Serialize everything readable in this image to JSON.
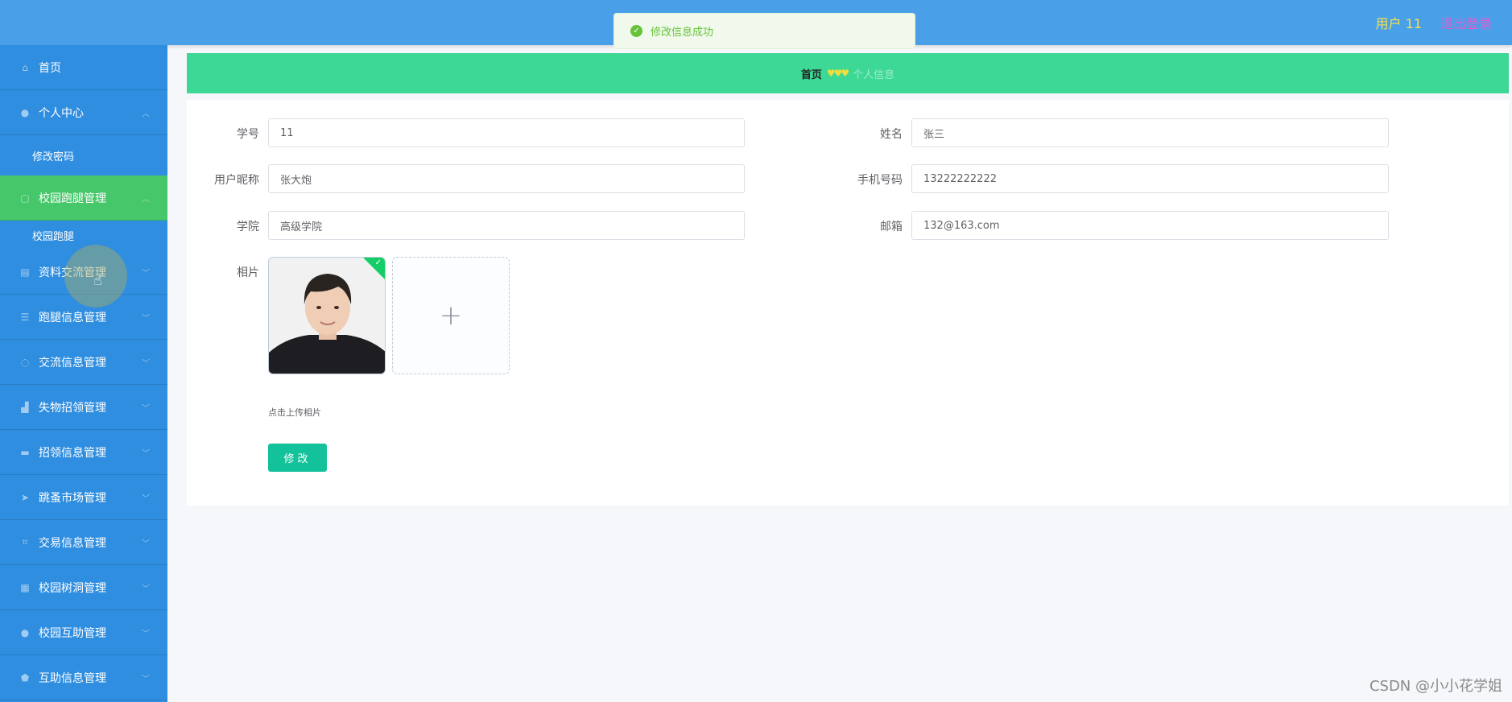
{
  "header": {
    "user_label": "用户 11",
    "logout_label": "退出登录"
  },
  "toast": {
    "message": "修改信息成功",
    "icon": "success-check-icon"
  },
  "sidebar": {
    "items": [
      {
        "label": "首页",
        "icon": "home-icon"
      },
      {
        "label": "个人中心",
        "icon": "user-icon",
        "sub": "修改密码"
      },
      {
        "label": "校园跑腿管理",
        "icon": "document-icon",
        "sub": "校园跑腿"
      },
      {
        "label": "资料交流管理",
        "icon": "clipboard-icon"
      },
      {
        "label": "跑腿信息管理",
        "icon": "list-icon"
      },
      {
        "label": "交流信息管理",
        "icon": "circle-icon"
      },
      {
        "label": "失物招领管理",
        "icon": "thumb-icon"
      },
      {
        "label": "招领信息管理",
        "icon": "folder-icon"
      },
      {
        "label": "跳蚤市场管理",
        "icon": "send-icon"
      },
      {
        "label": "交易信息管理",
        "icon": "crop-icon"
      },
      {
        "label": "校园树洞管理",
        "icon": "grid-icon"
      },
      {
        "label": "校园互助管理",
        "icon": "user-icon"
      },
      {
        "label": "互助信息管理",
        "icon": "shield-icon"
      }
    ]
  },
  "breadcrumb": {
    "home": "首页",
    "current": "个人信息"
  },
  "form": {
    "student_id_label": "学号",
    "student_id_value": "11",
    "name_label": "姓名",
    "name_value": "张三",
    "nickname_label": "用户昵称",
    "nickname_value": "张大炮",
    "phone_label": "手机号码",
    "phone_value": "13222222222",
    "college_label": "学院",
    "college_value": "高级学院",
    "email_label": "邮箱",
    "email_value": "132@163.com",
    "photo_label": "相片",
    "upload_hint": "点击上传相片",
    "submit_label": "修改"
  },
  "watermark": "CSDN @小小花学姐"
}
